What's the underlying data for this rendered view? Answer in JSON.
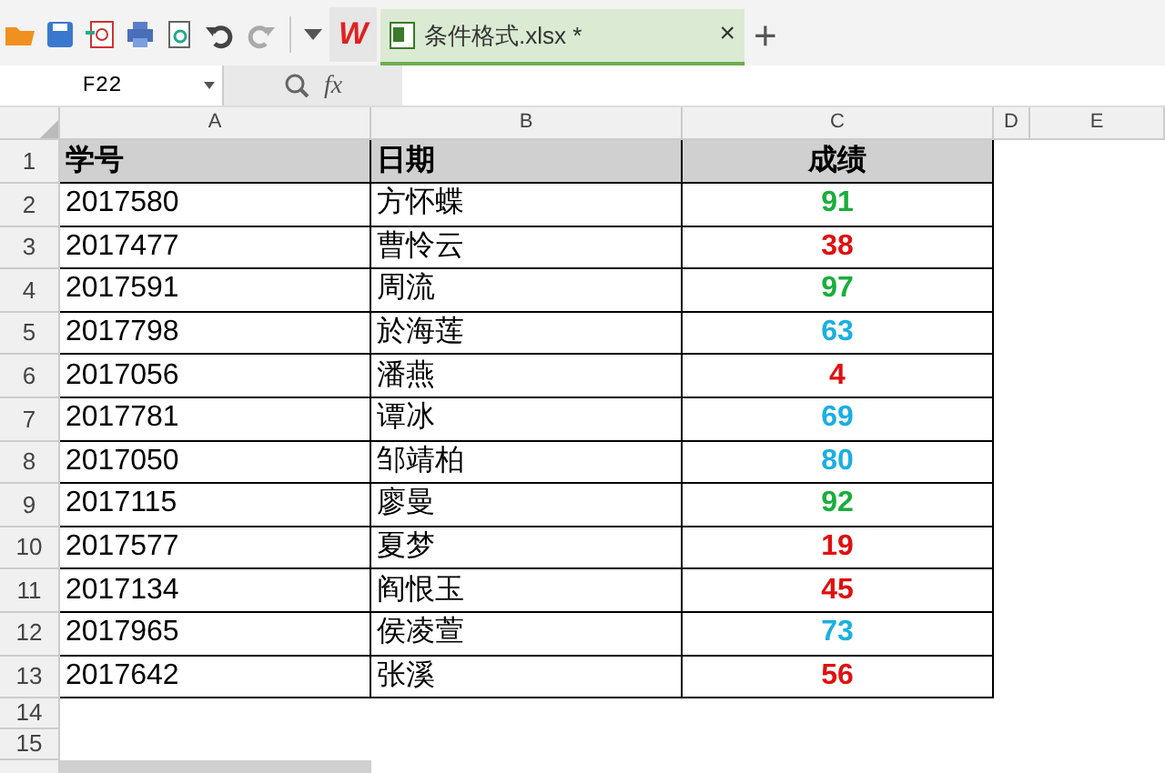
{
  "toolbar": {
    "logo": "W"
  },
  "tab": {
    "title": "条件格式.xlsx *",
    "selected": true,
    "close": "×",
    "new_tab": "+"
  },
  "formula_bar": {
    "name_box": "F22",
    "fx": "fx"
  },
  "columns": [
    {
      "label": "A",
      "selected": false
    },
    {
      "label": "B",
      "selected": false
    },
    {
      "label": "C",
      "selected": false
    },
    {
      "label": "D",
      "selected": false
    },
    {
      "label": "E",
      "selected": false
    }
  ],
  "header_row": {
    "row": "1",
    "cells": [
      "学号",
      "日期",
      "成绩"
    ]
  },
  "rows": [
    {
      "row": "2",
      "id": "2017580",
      "name": "方怀蝶",
      "score": "91",
      "color": "#1aae3c"
    },
    {
      "row": "3",
      "id": "2017477",
      "name": "曹怜云",
      "score": "38",
      "color": "#e01010"
    },
    {
      "row": "4",
      "id": "2017591",
      "name": "周流",
      "score": "97",
      "color": "#1aae3c"
    },
    {
      "row": "5",
      "id": "2017798",
      "name": "於海莲",
      "score": "63",
      "color": "#1ab0e0"
    },
    {
      "row": "6",
      "id": "2017056",
      "name": "潘燕",
      "score": "4",
      "color": "#e01010"
    },
    {
      "row": "7",
      "id": "2017781",
      "name": "谭冰",
      "score": "69",
      "color": "#1ab0e0"
    },
    {
      "row": "8",
      "id": "2017050",
      "name": "邹靖柏",
      "score": "80",
      "color": "#1ab0e0"
    },
    {
      "row": "9",
      "id": "2017115",
      "name": "廖曼",
      "score": "92",
      "color": "#1aae3c"
    },
    {
      "row": "10",
      "id": "2017577",
      "name": "夏梦",
      "score": "19",
      "color": "#e01010"
    },
    {
      "row": "11",
      "id": "2017134",
      "name": "阎恨玉",
      "score": "45",
      "color": "#e01010"
    },
    {
      "row": "12",
      "id": "2017965",
      "name": "侯凌萱",
      "score": "73",
      "color": "#1ab0e0"
    },
    {
      "row": "13",
      "id": "2017642",
      "name": "张溪",
      "score": "56",
      "color": "#e01010"
    }
  ],
  "empty_rows": [
    "14",
    "15"
  ]
}
